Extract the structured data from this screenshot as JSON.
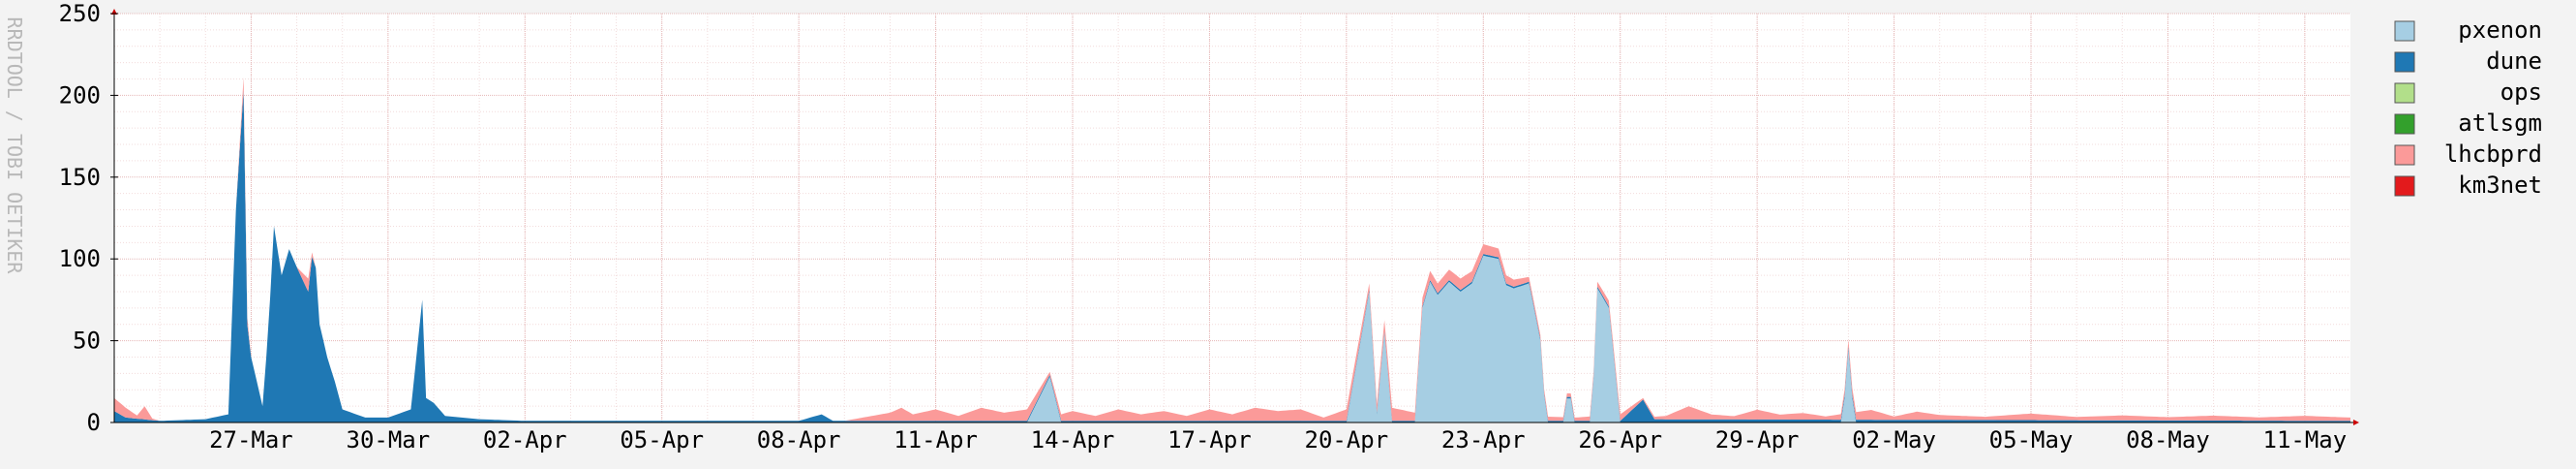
{
  "chart_data": {
    "type": "area",
    "stacked": true,
    "title": "",
    "xlabel": "",
    "ylabel": "RRDTOOL / TOBI OETIKER",
    "ylim": [
      0,
      250
    ],
    "yticks": [
      0,
      50,
      100,
      150,
      200,
      250
    ],
    "xlim": [
      "2024-03-24",
      "2024-05-12"
    ],
    "xticks": [
      {
        "date": "2024-03-27",
        "label": "27-Mar"
      },
      {
        "date": "2024-03-30",
        "label": "30-Mar"
      },
      {
        "date": "2024-04-02",
        "label": "02-Apr"
      },
      {
        "date": "2024-04-05",
        "label": "05-Apr"
      },
      {
        "date": "2024-04-08",
        "label": "08-Apr"
      },
      {
        "date": "2024-04-11",
        "label": "11-Apr"
      },
      {
        "date": "2024-04-14",
        "label": "14-Apr"
      },
      {
        "date": "2024-04-17",
        "label": "17-Apr"
      },
      {
        "date": "2024-04-20",
        "label": "20-Apr"
      },
      {
        "date": "2024-04-23",
        "label": "23-Apr"
      },
      {
        "date": "2024-04-26",
        "label": "26-Apr"
      },
      {
        "date": "2024-04-29",
        "label": "29-Apr"
      },
      {
        "date": "2024-05-02",
        "label": "02-May"
      },
      {
        "date": "2024-05-05",
        "label": "05-May"
      },
      {
        "date": "2024-05-08",
        "label": "08-May"
      },
      {
        "date": "2024-05-11",
        "label": "11-May"
      }
    ],
    "grid": true,
    "legend_position": "right",
    "colors": {
      "background": "#f3f3f3",
      "plot_background": "#ffffff",
      "grid_minor": "#f2dcdc",
      "grid_major": "#e6b8b8",
      "axis": "#000000",
      "frame_tick": "#cc0000"
    },
    "series": [
      {
        "name": "pxenon",
        "color": "#a6cee3",
        "points": [
          [
            "2024-03-24",
            0
          ],
          [
            "2024-04-13",
            0
          ],
          [
            "2024-04-13T12:00",
            28
          ],
          [
            "2024-04-13T18:00",
            0
          ],
          [
            "2024-04-20",
            0
          ],
          [
            "2024-04-20T12:00",
            80
          ],
          [
            "2024-04-20T16:00",
            5
          ],
          [
            "2024-04-20T20:00",
            55
          ],
          [
            "2024-04-21",
            0
          ],
          [
            "2024-04-21T12:00",
            0
          ],
          [
            "2024-04-21T16:00",
            70
          ],
          [
            "2024-04-21T20:00",
            86
          ],
          [
            "2024-04-22",
            78
          ],
          [
            "2024-04-22T06:00",
            86
          ],
          [
            "2024-04-22T12:00",
            80
          ],
          [
            "2024-04-22T18:00",
            85
          ],
          [
            "2024-04-23",
            102
          ],
          [
            "2024-04-23T08:00",
            100
          ],
          [
            "2024-04-23T12:00",
            84
          ],
          [
            "2024-04-23T16:00",
            82
          ],
          [
            "2024-04-24",
            85
          ],
          [
            "2024-04-24T06:00",
            50
          ],
          [
            "2024-04-24T09:00",
            0
          ],
          [
            "2024-04-24T18:00",
            0
          ],
          [
            "2024-04-24T21:00",
            22
          ],
          [
            "2024-04-25",
            0
          ],
          [
            "2024-04-25T09:00",
            0
          ],
          [
            "2024-04-25T12:00",
            82
          ],
          [
            "2024-04-25T18:00",
            70
          ],
          [
            "2024-04-26",
            0
          ],
          [
            "2024-04-30",
            0
          ],
          [
            "2024-04-30T21:00",
            0
          ],
          [
            "2024-05-01",
            45
          ],
          [
            "2024-05-01T03:00",
            0
          ],
          [
            "2024-05-12",
            0
          ]
        ]
      },
      {
        "name": "dune",
        "color": "#1f78b4",
        "points": [
          [
            "2024-03-24",
            7
          ],
          [
            "2024-03-24T06:00",
            3
          ],
          [
            "2024-03-25",
            1
          ],
          [
            "2024-03-26",
            2
          ],
          [
            "2024-03-26T12:00",
            5
          ],
          [
            "2024-03-26T16:00",
            130
          ],
          [
            "2024-03-26T20:00",
            203
          ],
          [
            "2024-03-26T22:00",
            60
          ],
          [
            "2024-03-27",
            40
          ],
          [
            "2024-03-27T06:00",
            10
          ],
          [
            "2024-03-27T09:00",
            55
          ],
          [
            "2024-03-27T12:00",
            120
          ],
          [
            "2024-03-27T16:00",
            90
          ],
          [
            "2024-03-27T20:00",
            106
          ],
          [
            "2024-03-28",
            95
          ],
          [
            "2024-03-28T06:00",
            80
          ],
          [
            "2024-03-28T09:00",
            112
          ],
          [
            "2024-03-28T12:00",
            60
          ],
          [
            "2024-03-28T16:00",
            40
          ],
          [
            "2024-03-28T20:00",
            25
          ],
          [
            "2024-03-29",
            8
          ],
          [
            "2024-03-29T12:00",
            3
          ],
          [
            "2024-03-30",
            3
          ],
          [
            "2024-03-30T12:00",
            8
          ],
          [
            "2024-03-30T18:00",
            75
          ],
          [
            "2024-03-30T20:00",
            15
          ],
          [
            "2024-03-31",
            12
          ],
          [
            "2024-03-31T06:00",
            4
          ],
          [
            "2024-04-01",
            2
          ],
          [
            "2024-04-02",
            1
          ],
          [
            "2024-04-08",
            1
          ],
          [
            "2024-04-08T12:00",
            5
          ],
          [
            "2024-04-08T18:00",
            1
          ],
          [
            "2024-04-26",
            1
          ],
          [
            "2024-04-26T12:00",
            14
          ],
          [
            "2024-04-26T18:00",
            2
          ],
          [
            "2024-05-12",
            1
          ]
        ]
      },
      {
        "name": "ops",
        "color": "#b2df8a",
        "points": [
          [
            "2024-03-24",
            0
          ],
          [
            "2024-05-12",
            0
          ]
        ]
      },
      {
        "name": "atlsgm",
        "color": "#33a02c",
        "points": [
          [
            "2024-03-24",
            0
          ],
          [
            "2024-05-12",
            0
          ]
        ]
      },
      {
        "name": "lhcbprd",
        "color": "#fb9a99",
        "points": [
          [
            "2024-03-24",
            8
          ],
          [
            "2024-03-24T06:00",
            6
          ],
          [
            "2024-03-24T12:00",
            2
          ],
          [
            "2024-03-24T16:00",
            8
          ],
          [
            "2024-03-24T20:00",
            1
          ],
          [
            "2024-03-25",
            0
          ],
          [
            "2024-03-26T16:00",
            0
          ],
          [
            "2024-03-26T20:00",
            8
          ],
          [
            "2024-03-27",
            0
          ],
          [
            "2024-03-28",
            0
          ],
          [
            "2024-03-28T06:00",
            8
          ],
          [
            "2024-03-28T09:00",
            0
          ],
          [
            "2024-04-09",
            0
          ],
          [
            "2024-04-10",
            5
          ],
          [
            "2024-04-10T06:00",
            8
          ],
          [
            "2024-04-10T12:00",
            4
          ],
          [
            "2024-04-11",
            7
          ],
          [
            "2024-04-11T12:00",
            3
          ],
          [
            "2024-04-12",
            8
          ],
          [
            "2024-04-12T12:00",
            5
          ],
          [
            "2024-04-13",
            7
          ],
          [
            "2024-04-13T12:00",
            2
          ],
          [
            "2024-04-14",
            6
          ],
          [
            "2024-04-14T12:00",
            3
          ],
          [
            "2024-04-15",
            7
          ],
          [
            "2024-04-15T12:00",
            4
          ],
          [
            "2024-04-16",
            6
          ],
          [
            "2024-04-16T12:00",
            3
          ],
          [
            "2024-04-17",
            7
          ],
          [
            "2024-04-17T12:00",
            4
          ],
          [
            "2024-04-18",
            8
          ],
          [
            "2024-04-18T12:00",
            6
          ],
          [
            "2024-04-19",
            7
          ],
          [
            "2024-04-19T12:00",
            2
          ],
          [
            "2024-04-20",
            7
          ],
          [
            "2024-04-20T12:00",
            4
          ],
          [
            "2024-04-21",
            8
          ],
          [
            "2024-04-21T12:00",
            5
          ],
          [
            "2024-04-22",
            6
          ],
          [
            "2024-04-22T12:00",
            7
          ],
          [
            "2024-04-23",
            6
          ],
          [
            "2024-04-23T12:00",
            5
          ],
          [
            "2024-04-24",
            3
          ],
          [
            "2024-04-25",
            2
          ],
          [
            "2024-04-26",
            4
          ],
          [
            "2024-04-26T12:00",
            1
          ],
          [
            "2024-04-27",
            2
          ],
          [
            "2024-04-27T12:00",
            8
          ],
          [
            "2024-04-28",
            3
          ],
          [
            "2024-04-28T12:00",
            2
          ],
          [
            "2024-04-29",
            6
          ],
          [
            "2024-04-29T12:00",
            3
          ],
          [
            "2024-04-30",
            4
          ],
          [
            "2024-04-30T12:00",
            2
          ],
          [
            "2024-05-01",
            4
          ],
          [
            "2024-05-01T12:00",
            6
          ],
          [
            "2024-05-02",
            2
          ],
          [
            "2024-05-02T12:00",
            5
          ],
          [
            "2024-05-03",
            3
          ],
          [
            "2024-05-04",
            2
          ],
          [
            "2024-05-05",
            4
          ],
          [
            "2024-05-06",
            2
          ],
          [
            "2024-05-07",
            3
          ],
          [
            "2024-05-08",
            2
          ],
          [
            "2024-05-09",
            3
          ],
          [
            "2024-05-10",
            2
          ],
          [
            "2024-05-11",
            3
          ],
          [
            "2024-05-12",
            2
          ]
        ]
      },
      {
        "name": "km3net",
        "color": "#e31a1c",
        "points": [
          [
            "2024-03-24",
            0
          ],
          [
            "2024-05-12",
            0
          ]
        ]
      }
    ]
  }
}
